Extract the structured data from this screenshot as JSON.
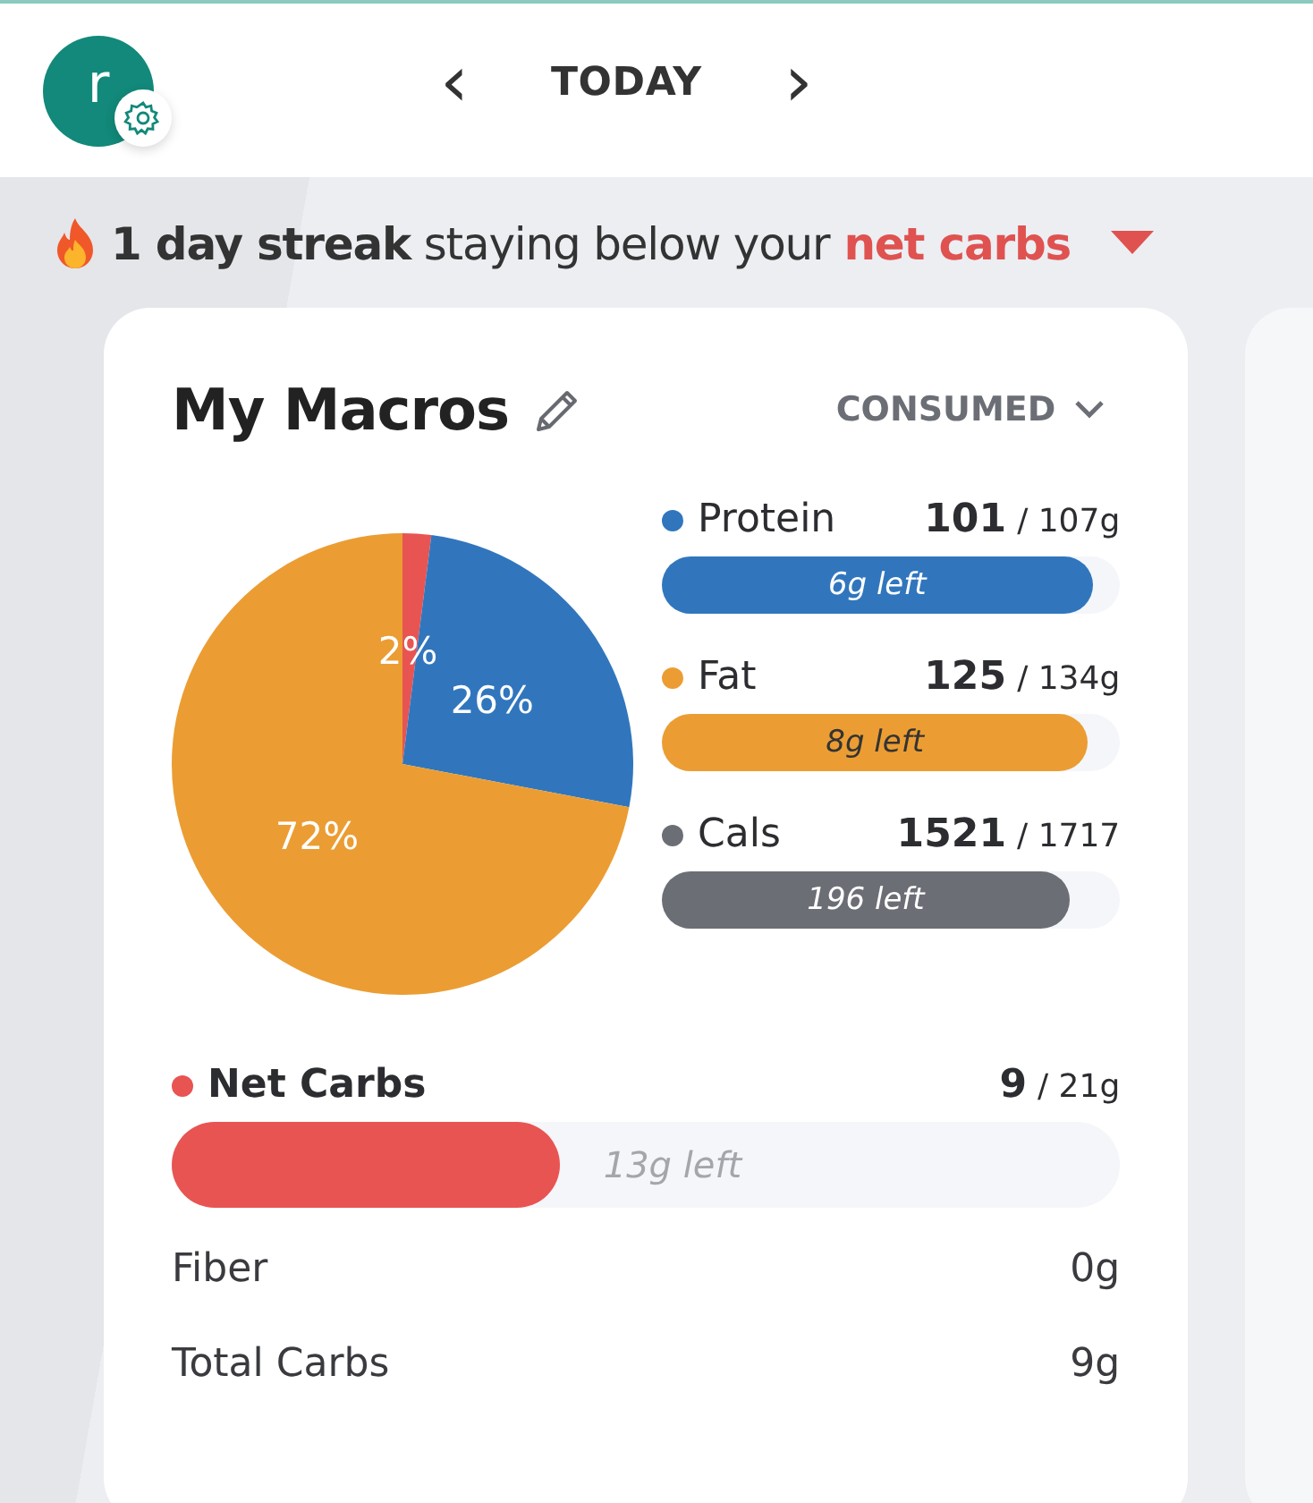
{
  "header": {
    "avatar_letter": "r",
    "title": "TODAY",
    "prev": "‹",
    "next": "›"
  },
  "streak": {
    "text": "**1 day streak** staying below your",
    "highlight": "net carbs"
  },
  "card": {
    "title": "My Macros",
    "mode": "CONSUMED",
    "chart_data": {
      "type": "pie",
      "values": [
        2,
        26,
        72
      ],
      "colors": [
        "#e85452",
        "#3176bd",
        "#eb9d33"
      ],
      "value_labels": [
        "2%",
        "26%",
        "72%"
      ]
    },
    "macros": [
      {
        "kind": "compact",
        "name": "Protein",
        "color": "#3176bd",
        "consumed": "101",
        "target": "/ 107g",
        "level": 0.94,
        "remaining": "6g left"
      },
      {
        "kind": "compact",
        "name": "Fat",
        "color": "#eb9d33",
        "consumed": "125",
        "target": "/ 134g",
        "level": 0.93,
        "remaining": "8g left"
      },
      {
        "kind": "compact",
        "name": "Cals",
        "color": "#6b6e74",
        "consumed": "1521",
        "target": "/ 1717",
        "level": 0.89,
        "remaining": "196 left"
      },
      {
        "kind": "wide",
        "name": "Net Carbs",
        "color": "#e85452",
        "consumed": "9",
        "target": "/ 21g",
        "level": 0.41,
        "remaining": "13g left"
      }
    ],
    "details": [
      {
        "label": "Fiber",
        "value": "0g"
      },
      {
        "label": "Total Carbs",
        "value": "9g"
      }
    ]
  }
}
